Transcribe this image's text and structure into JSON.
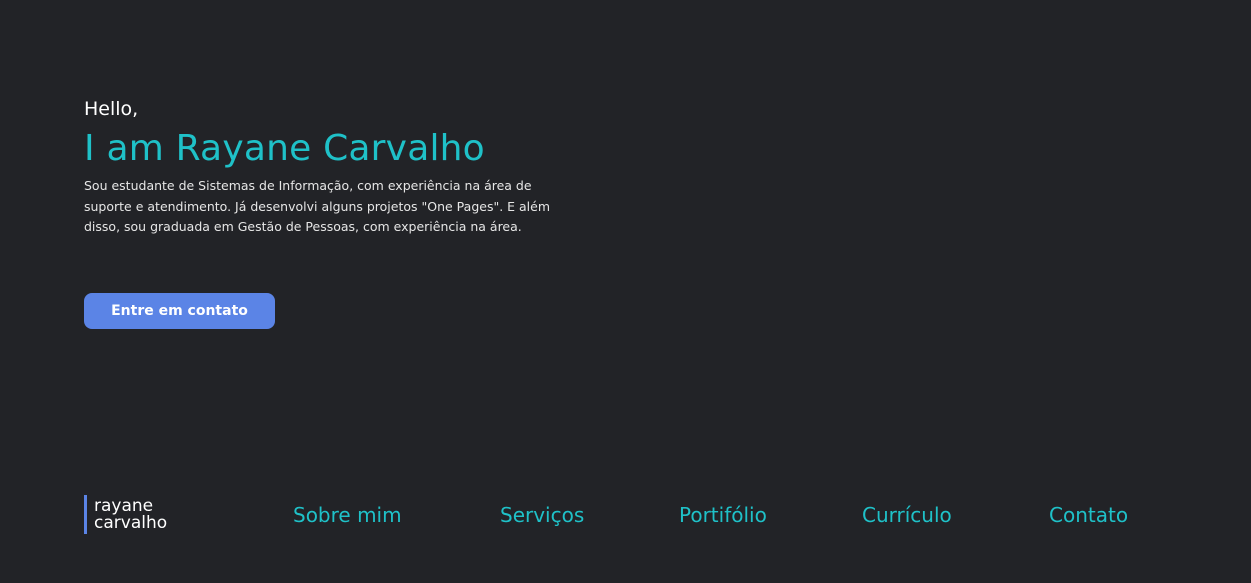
{
  "hero": {
    "greeting": "Hello,",
    "name": "I am Rayane Carvalho",
    "bio": "Sou estudante de Sistemas de Informação, com experiência na área de suporte e atendimento. Já desenvolvi alguns projetos \"One Pages\". E além disso, sou graduada em Gestão de Pessoas, com experiência na área.",
    "cta_label": "Entre em contato"
  },
  "nav": {
    "logo_line1": "rayane",
    "logo_line2": "carvalho",
    "items": [
      {
        "label": "Sobre mim"
      },
      {
        "label": "Serviços"
      },
      {
        "label": "Portifólio"
      },
      {
        "label": "Currículo"
      },
      {
        "label": "Contato"
      }
    ]
  },
  "colors": {
    "background": "#222327",
    "accent_teal": "#1fc1c8",
    "accent_blue": "#5b84e6",
    "text": "#ffffff"
  }
}
